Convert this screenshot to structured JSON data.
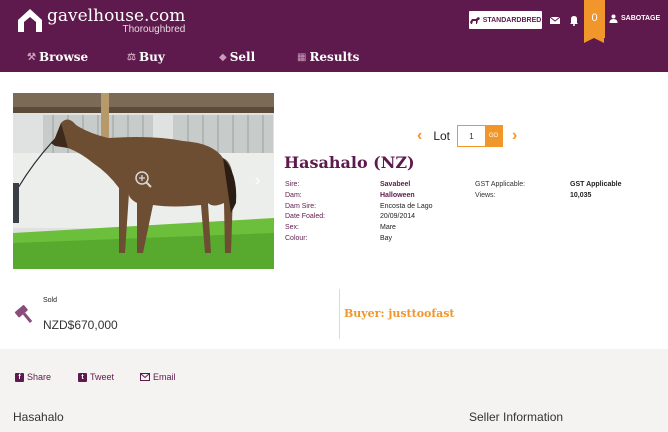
{
  "header": {
    "logo_text": "gavelhouse.com",
    "logo_sub": "Thoroughbred",
    "standardbred_label": "STANDARDBRED",
    "cart_count": "0",
    "user_label": "SABOTAGE"
  },
  "nav": {
    "items": [
      {
        "label": "Browse",
        "icon": "hammer-icon"
      },
      {
        "label": "Buy",
        "icon": "gavel-icon"
      },
      {
        "label": "Sell",
        "icon": "tag-icon"
      },
      {
        "label": "Results",
        "icon": "results-icon"
      }
    ]
  },
  "lot": {
    "label": "Lot",
    "value": "1",
    "go_label": "GO"
  },
  "horse": {
    "name": "Hasahalo (NZ)",
    "details_left": [
      {
        "label": "Sire:",
        "value": "Savabeel",
        "link": true
      },
      {
        "label": "Dam:",
        "value": "Halloween",
        "link": true
      },
      {
        "label": "Dam Sire:",
        "value": "Encosta de Lago",
        "link": false
      },
      {
        "label": "Date Foaled:",
        "value": "20/09/2014",
        "link": false
      },
      {
        "label": "Sex:",
        "value": "Mare",
        "link": false
      },
      {
        "label": "Colour:",
        "value": "Bay",
        "link": false
      }
    ],
    "details_right": [
      {
        "label": "GST Applicable:",
        "value": "GST Applicable"
      },
      {
        "label": "Views:",
        "value": "10,035"
      }
    ]
  },
  "sale": {
    "status": "Sold",
    "price": "NZD$670,000",
    "buyer": "Buyer: justtoofast"
  },
  "share": {
    "facebook": "Share",
    "twitter": "Tweet",
    "email": "Email"
  },
  "sections": {
    "left_title": "Hasahalo",
    "right_title": "Seller Information"
  },
  "colors": {
    "brand": "#5e1a4c",
    "accent": "#f0962b"
  }
}
